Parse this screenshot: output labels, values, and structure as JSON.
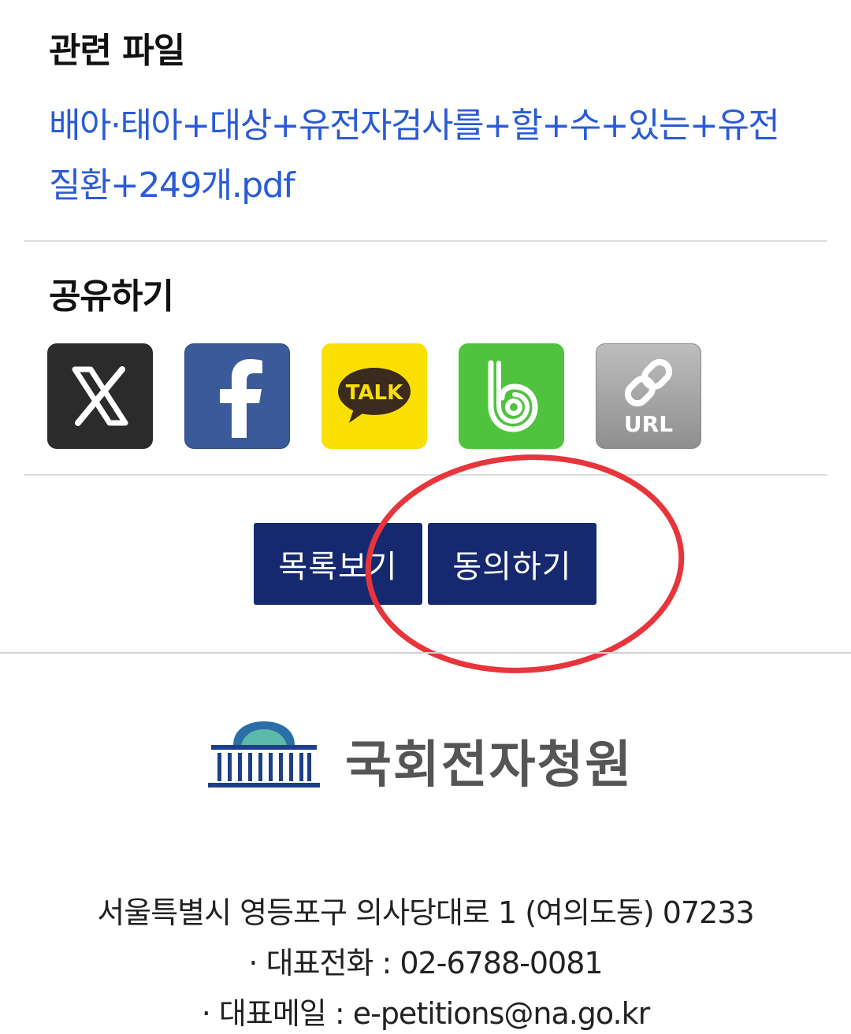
{
  "files": {
    "title": "관련 파일",
    "link": "배아·태아+대상+유전자검사를+할+수+있는+유전질환+249개.pdf"
  },
  "share": {
    "title": "공유하기",
    "items": [
      {
        "name": "x",
        "icon": "x-logo-icon"
      },
      {
        "name": "facebook",
        "icon": "facebook-icon"
      },
      {
        "name": "kakaotalk",
        "icon": "kakaotalk-icon",
        "label": "TALK"
      },
      {
        "name": "band",
        "icon": "band-icon"
      },
      {
        "name": "url",
        "icon": "link-icon",
        "label": "URL"
      }
    ]
  },
  "actions": {
    "list_label": "목록보기",
    "agree_label": "동의하기"
  },
  "logo": {
    "text": "국회전자청원"
  },
  "footer": {
    "address": "서울특별시 영등포구 의사당대로 1 (여의도동) 07233",
    "tel": "· 대표전화 : 02-6788-0081",
    "email": "· 대표메일 : e-petitions@na.go.kr"
  },
  "colors": {
    "link": "#2a5bd7",
    "button": "#16296f",
    "annotation": "#e8343b"
  }
}
